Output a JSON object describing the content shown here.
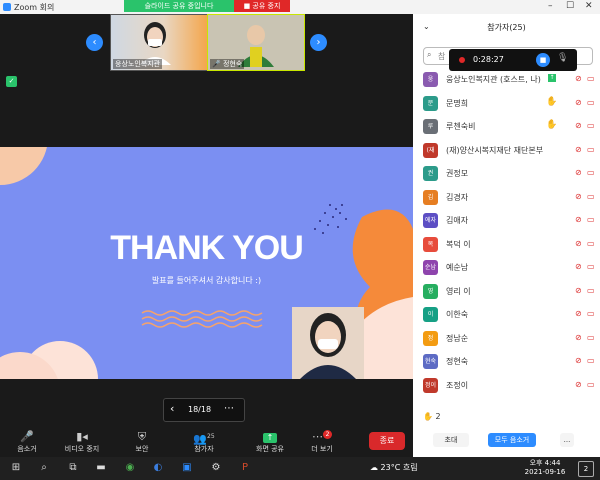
{
  "window": {
    "title": "Zoom 회의",
    "minimize": "–",
    "maximize": "☐",
    "close": "✕"
  },
  "share_banner": {
    "status": "슬라이드 공유 중입니다",
    "stop": "■ 공유 중지"
  },
  "thumbnails": [
    {
      "name": "웅상노인복지관"
    },
    {
      "name": "정현숙"
    }
  ],
  "slide": {
    "title": "THANK YOU",
    "subtitle": "발표를 들어주셔서 감사합니다 :)"
  },
  "pager": {
    "text": "18/18",
    "prev": "‹",
    "next": "›",
    "more": "⋯"
  },
  "toolbar": {
    "audio": "음소거",
    "video": "비디오 중지",
    "security": "보안",
    "participants": "참가자",
    "participants_count": "25",
    "share": "화면 공유",
    "more": "더 보기",
    "more_badge": "2",
    "end": "종료"
  },
  "panel": {
    "header": "참가자(25)",
    "search_placeholder": "참",
    "recording_time": "0:28:27",
    "participants": [
      {
        "initial": "웅",
        "name": "웅상노인복지관 (호스트, 나)",
        "color": "#8a5bb0",
        "hand": false
      },
      {
        "initial": "문",
        "name": "문명희",
        "color": "#2c9b8a",
        "hand": true
      },
      {
        "initial": "루",
        "name": "루첸숙비",
        "color": "#6a6f76",
        "hand": true
      },
      {
        "initial": "(재",
        "name": "(재)양산시복지재단 재단본부",
        "color": "#c0392b",
        "hand": false
      },
      {
        "initial": "권",
        "name": "권정모",
        "color": "#2c9b8a",
        "hand": false
      },
      {
        "initial": "김",
        "name": "김경자",
        "color": "#e67e22",
        "hand": false
      },
      {
        "initial": "에자",
        "name": "김애자",
        "color": "#5d4fc4",
        "hand": false
      },
      {
        "initial": "복",
        "name": "복덕 이",
        "color": "#e74c3c",
        "hand": false
      },
      {
        "initial": "순남",
        "name": "예순남",
        "color": "#8e44ad",
        "hand": false
      },
      {
        "initial": "영",
        "name": "영리 이",
        "color": "#27ae60",
        "hand": false
      },
      {
        "initial": "이",
        "name": "이한숙",
        "color": "#16a085",
        "hand": false
      },
      {
        "initial": "정",
        "name": "정남순",
        "color": "#f39c12",
        "hand": false
      },
      {
        "initial": "현숙",
        "name": "정현숙",
        "color": "#5d6bc4",
        "hand": false
      },
      {
        "initial": "정이",
        "name": "조정이",
        "color": "#c0392b",
        "hand": false
      }
    ],
    "raised_hands": "2",
    "invite": "초대",
    "mute_all": "모두 음소거",
    "more": "..."
  },
  "taskbar": {
    "weather": "23°C 흐림",
    "time": "오후 4:44",
    "date": "2021-09-16",
    "notif": "2"
  }
}
